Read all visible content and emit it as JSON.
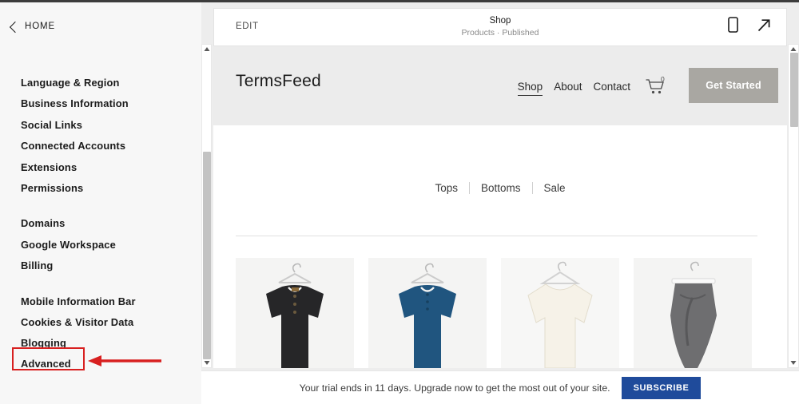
{
  "settings_panel": {
    "back_label": "HOME",
    "back_icon": "chevron-left-icon",
    "groups": [
      {
        "items": [
          {
            "label": "Language & Region",
            "active": false
          },
          {
            "label": "Business Information",
            "active": false
          },
          {
            "label": "Social Links",
            "active": false
          },
          {
            "label": "Connected Accounts",
            "active": false
          },
          {
            "label": "Extensions",
            "active": false
          },
          {
            "label": "Permissions",
            "active": false
          }
        ]
      },
      {
        "items": [
          {
            "label": "Domains",
            "active": false
          },
          {
            "label": "Google Workspace",
            "active": false
          },
          {
            "label": "Billing",
            "active": false
          }
        ]
      },
      {
        "items": [
          {
            "label": "Mobile Information Bar",
            "active": false
          },
          {
            "label": "Cookies & Visitor Data",
            "active": false
          },
          {
            "label": "Blogging",
            "active": false
          },
          {
            "label": "Advanced",
            "active": true
          }
        ]
      }
    ]
  },
  "annotation": {
    "highlight_target": "Advanced",
    "color": "#d82020",
    "arrow_icon": "arrow-left-icon"
  },
  "edit_bar": {
    "edit_label": "EDIT",
    "page_title": "Shop",
    "page_status": "Products · Published",
    "mobile_icon": "mobile-preview-icon",
    "external_icon": "open-external-icon"
  },
  "site": {
    "logo": "TermsFeed",
    "nav": [
      {
        "label": "Shop",
        "active": true
      },
      {
        "label": "About",
        "active": false
      },
      {
        "label": "Contact",
        "active": false
      }
    ],
    "cart": {
      "icon": "shopping-cart-icon",
      "count": "0"
    },
    "cta_label": "Get Started",
    "cta_color": "#a9a7a2",
    "categories": [
      "Tops",
      "Bottoms",
      "Sale"
    ],
    "products": [
      {
        "name": "black short-sleeve henley shirt",
        "color": "#262628"
      },
      {
        "name": "blue short-sleeve henley shirt",
        "color": "#20557f"
      },
      {
        "name": "cream oversized blouse",
        "color": "#f4f0e6"
      },
      {
        "name": "grey pleated strapless dress",
        "color": "#6e6e70"
      }
    ]
  },
  "scrollbars": {
    "left": {
      "name": "preview-left-scrollbar",
      "thumb_top_pct": 33,
      "thumb_height_pct": 66
    },
    "right": {
      "name": "preview-right-scrollbar",
      "thumb_top_pct": 2,
      "thumb_height_pct": 25
    }
  },
  "trial_bar": {
    "message": "Your trial ends in 11 days. Upgrade now to get the most out of your site.",
    "subscribe_label": "SUBSCRIBE",
    "subscribe_color": "#1f4b9b"
  }
}
